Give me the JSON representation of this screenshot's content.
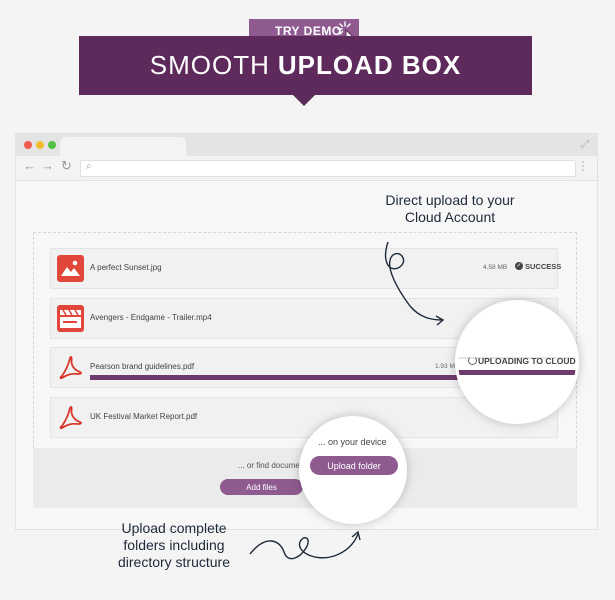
{
  "promo": {
    "demo_label": "TRY DEMO",
    "title_thin": "SMOOTH",
    "title_bold": "UPLOAD BOX"
  },
  "annotations": {
    "cloud_line1": "Direct upload to your",
    "cloud_line2": "Cloud Account",
    "folder_line1": "Upload complete",
    "folder_line2": "folders including",
    "folder_line3": "directory structure"
  },
  "files": [
    {
      "name": "A perfect Sunset.jpg",
      "size": "4.58 MB",
      "status": "SUCCESS",
      "icon": "image-icon"
    },
    {
      "name": "Avengers - Endgame - Trailer.mp4",
      "size": "",
      "status": "",
      "icon": "video-clapper-icon"
    },
    {
      "name": "Pearson brand guidelines.pdf",
      "size": "1.93 MB",
      "status": "UPLOADING TO CLOUD",
      "icon": "pdf-icon",
      "progress": 1.0
    },
    {
      "name": "UK Festival Market Report.pdf",
      "size": "",
      "status": "",
      "icon": "pdf-icon"
    }
  ],
  "footer": {
    "device_text": "... on your device",
    "find_text": "... or find documen",
    "upload_folder_label": "Upload folder",
    "add_files_label": "Add files"
  },
  "colors": {
    "banner": "#5d2a5b",
    "accent": "#8e5a90",
    "progress": "#6f3a6e",
    "image_icon": "#e0473a",
    "pdf_icon": "#d8372a"
  }
}
